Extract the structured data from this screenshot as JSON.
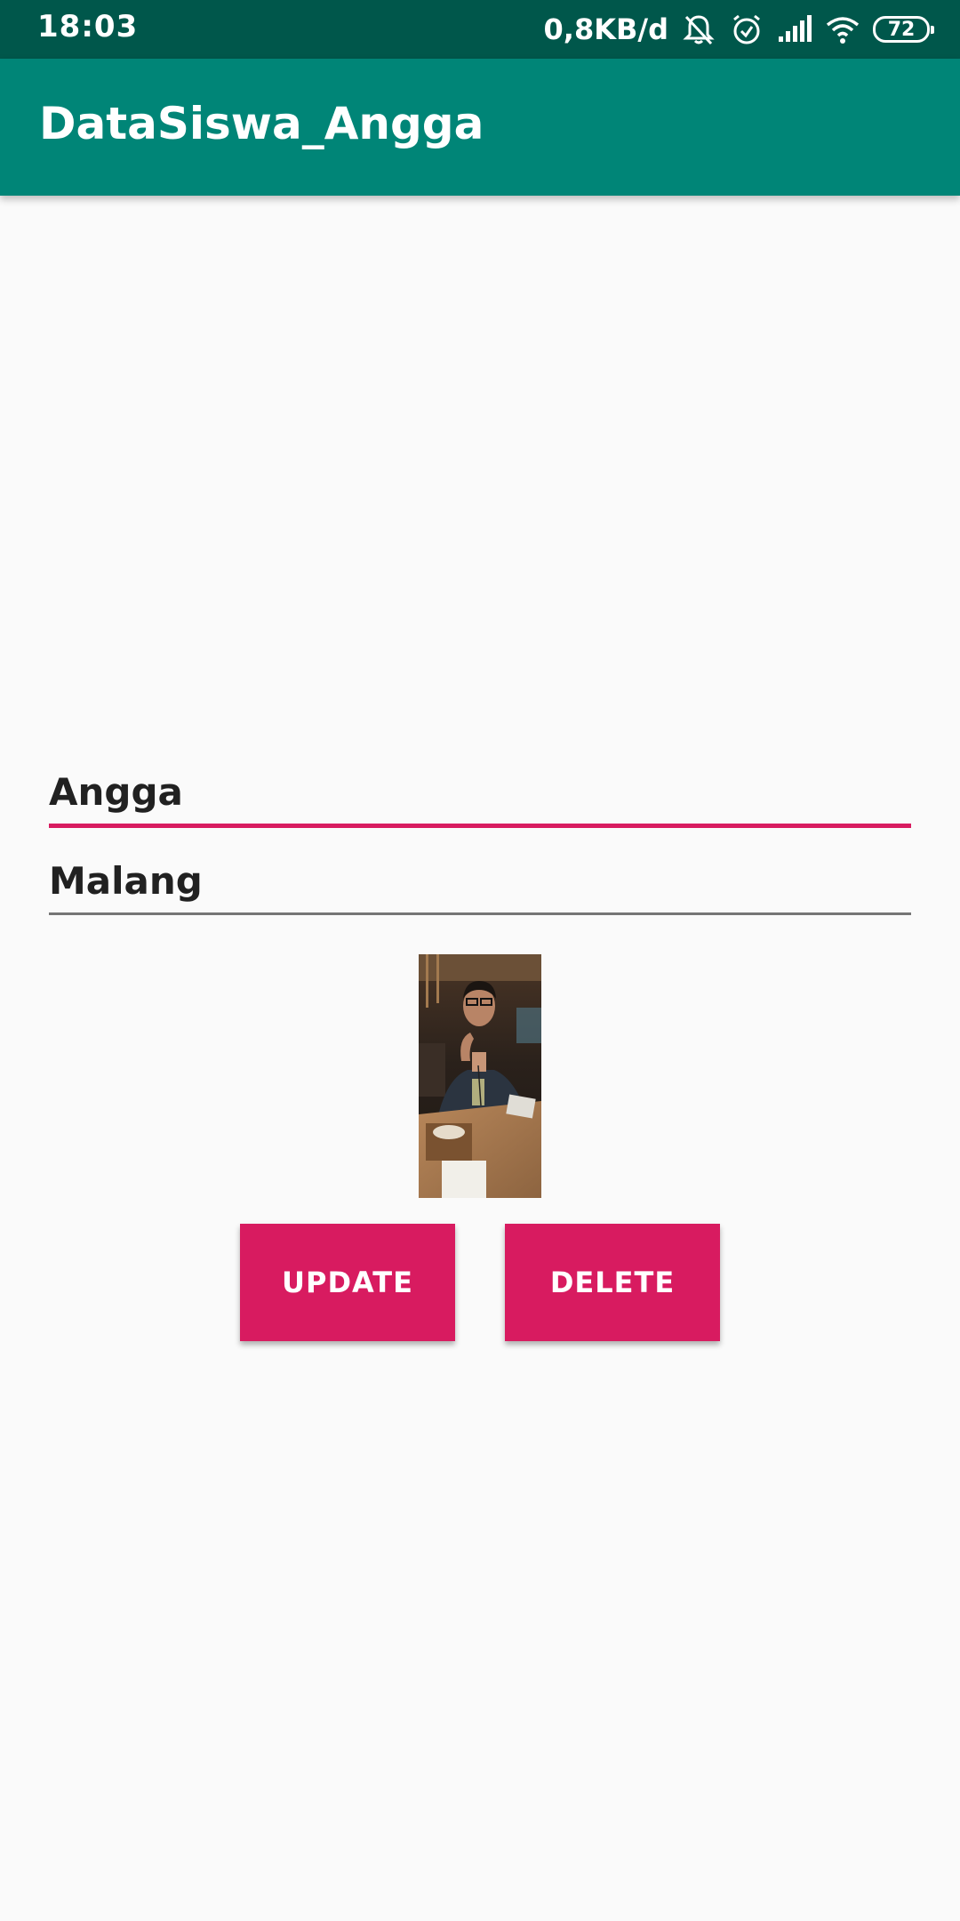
{
  "status_bar": {
    "time": "18:03",
    "net_speed": "0,8KB/d",
    "battery_level": "72",
    "icons": [
      "bell-muted-icon",
      "alarm-icon",
      "signal-icon",
      "wifi-icon",
      "battery-icon"
    ]
  },
  "app_bar": {
    "title": "DataSiswa_Angga",
    "color": "#008577"
  },
  "form": {
    "name_value": "Angga",
    "city_value": "Malang",
    "accent_color": "#d81b60"
  },
  "photo": {
    "description_icon": "student-photo"
  },
  "buttons": {
    "update_label": "UPDATE",
    "delete_label": "DELETE",
    "color": "#d81b60"
  }
}
